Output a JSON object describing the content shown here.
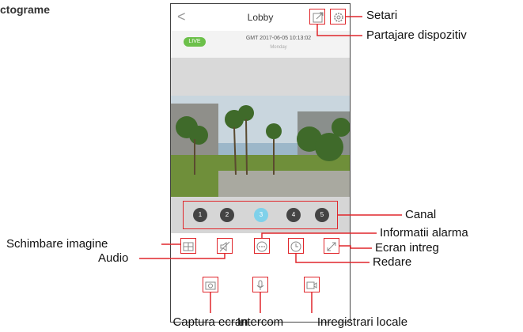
{
  "heading": "ctograme",
  "phone": {
    "title": "Lobby",
    "back_glyph": "<",
    "live_badge": "LIVE",
    "timestamp": "GMT 2017-06-05 10:13:02",
    "weekday": "Monday",
    "channels": [
      "1",
      "2",
      "3",
      "4",
      "5"
    ],
    "active_channel": "3",
    "top_icons": [
      "share-icon",
      "gear-icon"
    ],
    "toolbar_icons": [
      "layout-icon",
      "mute-icon",
      "alarm-info-icon",
      "playback-icon",
      "fullscreen-icon"
    ],
    "bottom_icons": [
      "camera-icon",
      "microphone-icon",
      "video-record-icon"
    ]
  },
  "labels": {
    "setari": "Setari",
    "partajare": "Partajare dispozitiv",
    "canal": "Canal",
    "schimbare": "Schimbare imagine",
    "informatii": "Informatii alarma",
    "audio": "Audio",
    "ecran": "Ecran intreg",
    "redare": "Redare",
    "captura": "Captura ecran",
    "intercom": "Intercom",
    "inregistrari": "Inregistrari locale"
  },
  "colors": {
    "callout": "#e0262b",
    "live": "#6cc04a",
    "active_channel": "#7fd1ea"
  }
}
